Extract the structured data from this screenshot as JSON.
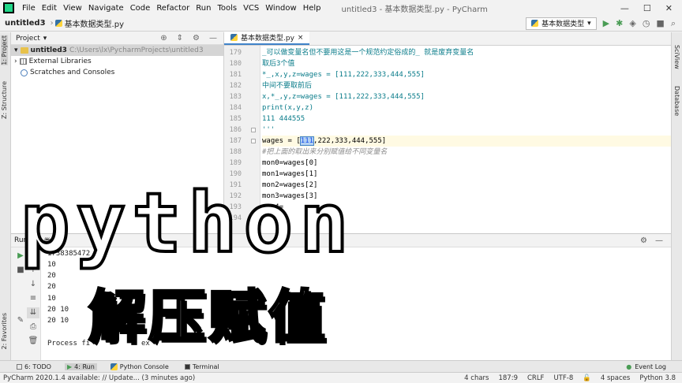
{
  "menubar": {
    "items": [
      "File",
      "Edit",
      "View",
      "Navigate",
      "Code",
      "Refactor",
      "Run",
      "Tools",
      "VCS",
      "Window",
      "Help"
    ],
    "window_title": "untitled3 - 基本数据类型.py - PyCharm",
    "controls": [
      "—",
      "☐",
      "✕"
    ]
  },
  "navbar": {
    "project": "untitled3",
    "file": "基本数据类型.py",
    "run_config": "基本数据类型"
  },
  "stripes": {
    "left": [
      "1: Project",
      "Z: Structure",
      "2: Favorites"
    ],
    "right": [
      "SciView",
      "Database"
    ]
  },
  "project_panel": {
    "title": "Project",
    "rows": [
      {
        "label": "untitled3",
        "path": "C:\\Users\\lx\\PycharmProjects\\untitled3"
      },
      {
        "label": "External Libraries",
        "path": ""
      },
      {
        "label": "Scratches and Consoles",
        "path": ""
      }
    ]
  },
  "editor": {
    "tab": "基本数据类型.py",
    "lines": [
      {
        "n": "179",
        "text": "_可以做变量名但不要用这是一个规范约定俗成的_ 就是废弃变量名"
      },
      {
        "n": "180",
        "text": "取后3个值"
      },
      {
        "n": "181",
        "text": "*_,x,y,z=wages = [111,222,333,444,555]"
      },
      {
        "n": "182",
        "text": "中间不要取前后"
      },
      {
        "n": "183",
        "text": "x,*_,y,z=wages = [111,222,333,444,555]"
      },
      {
        "n": "184",
        "text": "print(x,y,z)"
      },
      {
        "n": "185",
        "text": "111 444555"
      },
      {
        "n": "186",
        "text": "'''"
      },
      {
        "n": "187",
        "text_pre": "wages = [",
        "text_sel": "111",
        "text_post": ",222,333,444,555]"
      },
      {
        "n": "188",
        "text": "#把上面的取出来分别赋值给不同变量名"
      },
      {
        "n": "189",
        "text": "mon0=wages[0]"
      },
      {
        "n": "190",
        "text": "mon1=wages[1]"
      },
      {
        "n": "191",
        "text": "mon2=wages[2]"
      },
      {
        "n": "192",
        "text": "mon3=wages[3]"
      },
      {
        "n": "193",
        "text": "mon4="
      },
      {
        "n": "194",
        "text": ""
      }
    ]
  },
  "run_panel": {
    "title": "Run:",
    "config": "类型",
    "output": [
      "1738385472",
      "10",
      "20",
      "20",
      "10",
      "20 10",
      "20 10",
      "",
      "Process fi",
      "ex"
    ]
  },
  "bottom_tools": [
    {
      "label": "6: TODO"
    },
    {
      "label": "4: Run"
    },
    {
      "label": "Python Console"
    },
    {
      "label": "Terminal"
    }
  ],
  "event_log": "Event Log",
  "statusbar": {
    "message": "PyCharm 2020.1.4 available: // Update... (3 minutes ago)",
    "chars": "4 chars",
    "position": "187:9",
    "line_sep": "CRLF",
    "encoding": "UTF-8",
    "indent": "4 spaces",
    "interpreter": "Python 3.8"
  },
  "overlay": {
    "title": "python",
    "subtitle": "解压赋值"
  }
}
